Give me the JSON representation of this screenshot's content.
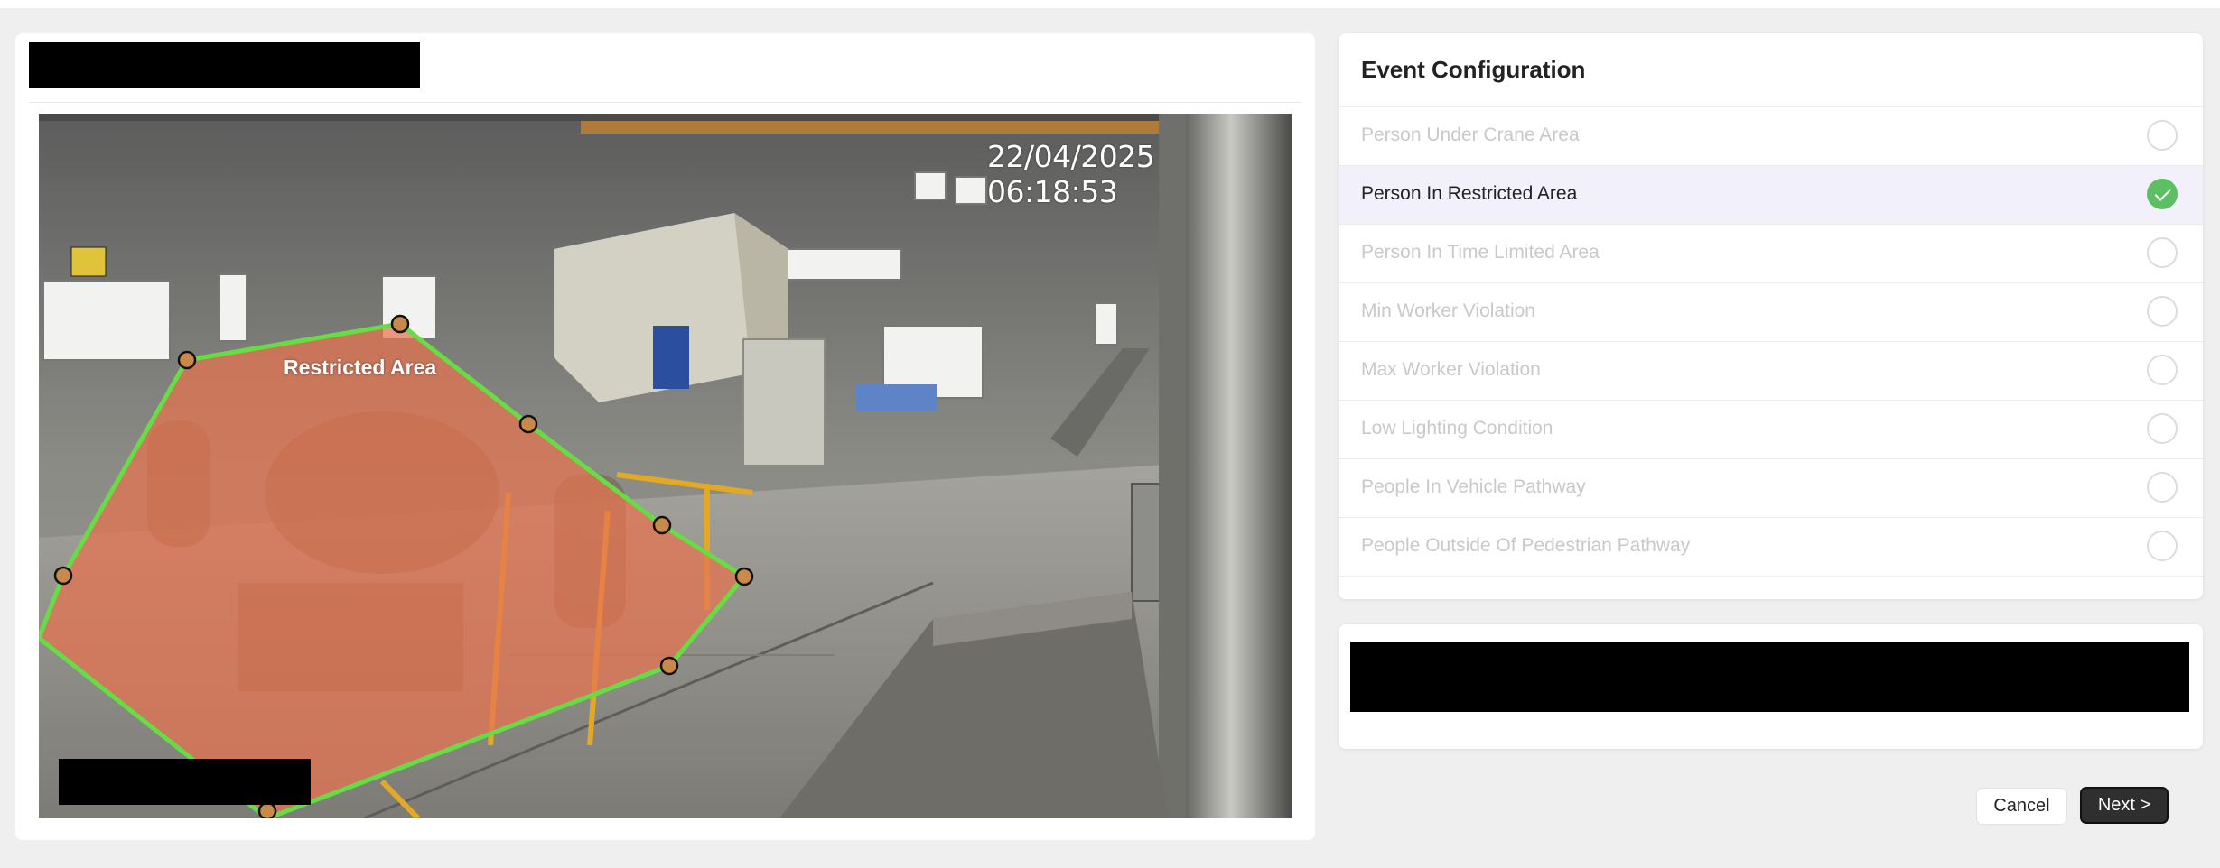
{
  "camera": {
    "timestamp": "22/04/2025 06:18:53",
    "zone_label": "Restricted Area",
    "zone_fill_color": "#e8734f",
    "zone_border_color": "#66dd44"
  },
  "event_config": {
    "title": "Event Configuration",
    "events": [
      {
        "label": "Person Under Crane Area",
        "selected": false
      },
      {
        "label": "Person In Restricted Area",
        "selected": true
      },
      {
        "label": "Person In Time Limited Area",
        "selected": false
      },
      {
        "label": "Min Worker Violation",
        "selected": false
      },
      {
        "label": "Max Worker Violation",
        "selected": false
      },
      {
        "label": "Low Lighting Condition",
        "selected": false
      },
      {
        "label": "People In Vehicle Pathway",
        "selected": false
      },
      {
        "label": "People Outside Of Pedestrian Pathway",
        "selected": false
      }
    ]
  },
  "actions": {
    "cancel_label": "Cancel",
    "next_label": "Next >"
  },
  "colors": {
    "selected_check": "#5cbf63",
    "selected_row_bg": "#f2f1fb",
    "primary_button": "#2f2f2f"
  }
}
